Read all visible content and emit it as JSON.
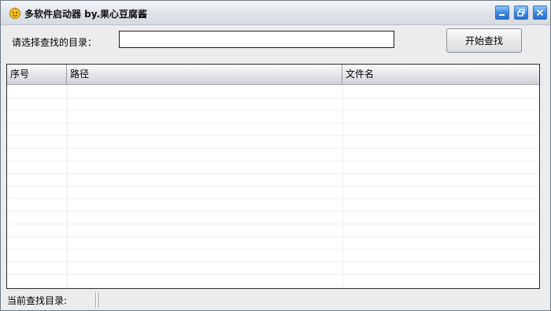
{
  "window": {
    "title": "多软件启动器 by.果心豆腐酱",
    "icon": "app-smiley-icon",
    "controls": [
      "minimize-icon",
      "restore-icon",
      "close-icon"
    ]
  },
  "search": {
    "label": "请选择查找的目录：",
    "value": "",
    "button_label": "开始查找"
  },
  "table": {
    "columns": [
      "序号",
      "路径",
      "文件名"
    ],
    "rows": []
  },
  "status": {
    "label": "当前查找目录:",
    "value": ""
  },
  "colors": {
    "title_button_blue": "#3b86e0",
    "window_bg": "#ececec",
    "table_bg": "#ffffff"
  }
}
